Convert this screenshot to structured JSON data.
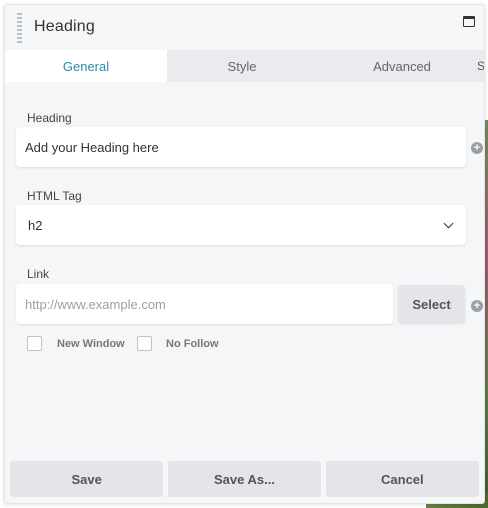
{
  "header": {
    "title": "Heading"
  },
  "tabs": [
    {
      "label": "General",
      "active": true
    },
    {
      "label": "Style",
      "active": false
    },
    {
      "label": "Advanced",
      "active": false
    }
  ],
  "tab_overflow": "S",
  "fields": {
    "heading": {
      "label": "Heading",
      "value": "Add your Heading here"
    },
    "html_tag": {
      "label": "HTML Tag",
      "value": "h2"
    },
    "link": {
      "label": "Link",
      "placeholder": "http://www.example.com",
      "select_label": "Select"
    }
  },
  "checkboxes": {
    "new_window": {
      "label": "New Window",
      "checked": false
    },
    "no_follow": {
      "label": "No Follow",
      "checked": false
    }
  },
  "footer": {
    "save": "Save",
    "save_as": "Save As...",
    "cancel": "Cancel"
  },
  "colors": {
    "accent": "#2a8bb0",
    "panel_bg": "#f5f6f8",
    "button_bg": "#e3e5e9"
  }
}
